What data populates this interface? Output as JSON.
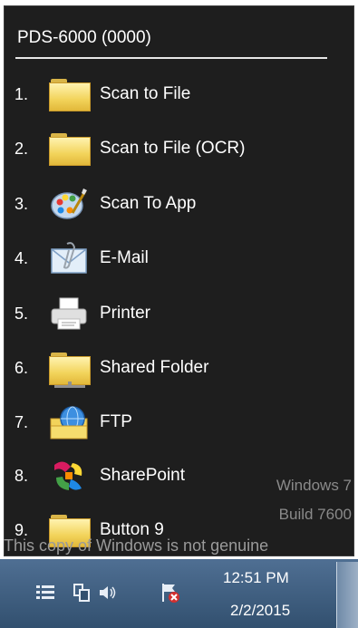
{
  "panel": {
    "title": "PDS-6000 (0000)",
    "items": [
      {
        "number": "1.",
        "label": "Scan to File",
        "icon": "folder-icon"
      },
      {
        "number": "2.",
        "label": "Scan to File (OCR)",
        "icon": "folder-icon"
      },
      {
        "number": "3.",
        "label": "Scan To App",
        "icon": "paint-palette-icon"
      },
      {
        "number": "4.",
        "label": "E-Mail",
        "icon": "email-icon"
      },
      {
        "number": "5.",
        "label": "Printer",
        "icon": "printer-icon"
      },
      {
        "number": "6.",
        "label": "Shared Folder",
        "icon": "shared-folder-icon"
      },
      {
        "number": "7.",
        "label": "FTP",
        "icon": "ftp-icon"
      },
      {
        "number": "8.",
        "label": "SharePoint",
        "icon": "sharepoint-icon"
      },
      {
        "number": "9.",
        "label": "Button 9",
        "icon": "folder-icon"
      }
    ]
  },
  "watermark": {
    "line1": "Windows 7",
    "line2": "Build 7600",
    "line3": "This copy of Windows is not genuine"
  },
  "taskbar": {
    "time": "12:51 PM",
    "date": "2/2/2015",
    "tray_icons": [
      "list-icon",
      "network-icon",
      "speaker-icon",
      "action-center-flag-icon"
    ]
  }
}
